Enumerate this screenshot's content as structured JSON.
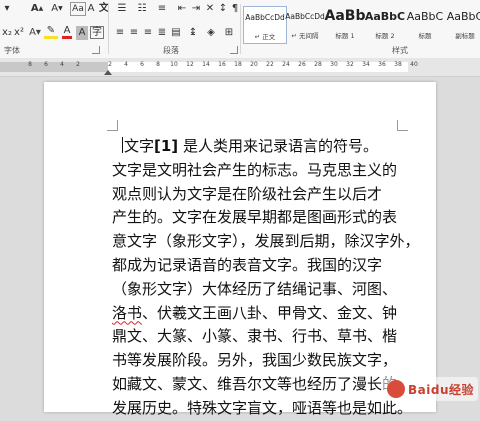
{
  "ribbon": {
    "groups": {
      "font_label": "字体",
      "paragraph_label": "段落",
      "styles_label": "样式"
    },
    "styles": [
      {
        "sample": "AaBbCcDd",
        "name": "↵ 正文",
        "selected": true
      },
      {
        "sample": "AaBbCcDd",
        "name": "↵ 无间隔",
        "selected": false
      },
      {
        "sample": "AaBb",
        "name": "标题 1",
        "selected": false
      },
      {
        "sample": "AaBbC",
        "name": "标题 2",
        "selected": false
      },
      {
        "sample": "AaBbC",
        "name": "标题",
        "selected": false
      },
      {
        "sample": "AaBbC",
        "name": "副标题",
        "selected": false
      }
    ]
  },
  "ruler": {
    "numbers": [
      "8",
      "6",
      "4",
      "2",
      "",
      "2",
      "4",
      "6",
      "8",
      "10",
      "12",
      "14",
      "16",
      "18",
      "20",
      "22",
      "24",
      "26",
      "28",
      "30",
      "32",
      "34",
      "36",
      "38",
      "40"
    ]
  },
  "document": {
    "lines": [
      {
        "pre": "文字",
        "ref": "[1]",
        "post": " 是人类用来记录语言的符号。"
      },
      {
        "text": "文字是文明社会产生的标志。马克思主义的"
      },
      {
        "text": "观点则认为文字是在阶级社会产生以后才"
      },
      {
        "text": "产生的。文字在发展早期都是图画形式的表"
      },
      {
        "text": "意文字（象形文字），发展到后期，除汉字外，"
      },
      {
        "text": "都成为记录语音的表音文字。我国的汉字"
      },
      {
        "text": "（象形文字）大体经历了结绳记事、河图、"
      },
      {
        "squiggle": "洛书",
        "text": "、伏羲文王画八卦、甲骨文、金文、钟"
      },
      {
        "text": "鼎文、大篆、小篆、隶书、行书、草书、楷"
      },
      {
        "text": "书等发展阶段。另外，我国少数民族文字，"
      },
      {
        "text": "如藏文、蒙文、维吾尔文等也经历了漫长的"
      },
      {
        "text": "发展历史。特殊文字盲文，哑语等也是如此。"
      }
    ]
  },
  "watermark": {
    "text": "Baidu经验"
  }
}
